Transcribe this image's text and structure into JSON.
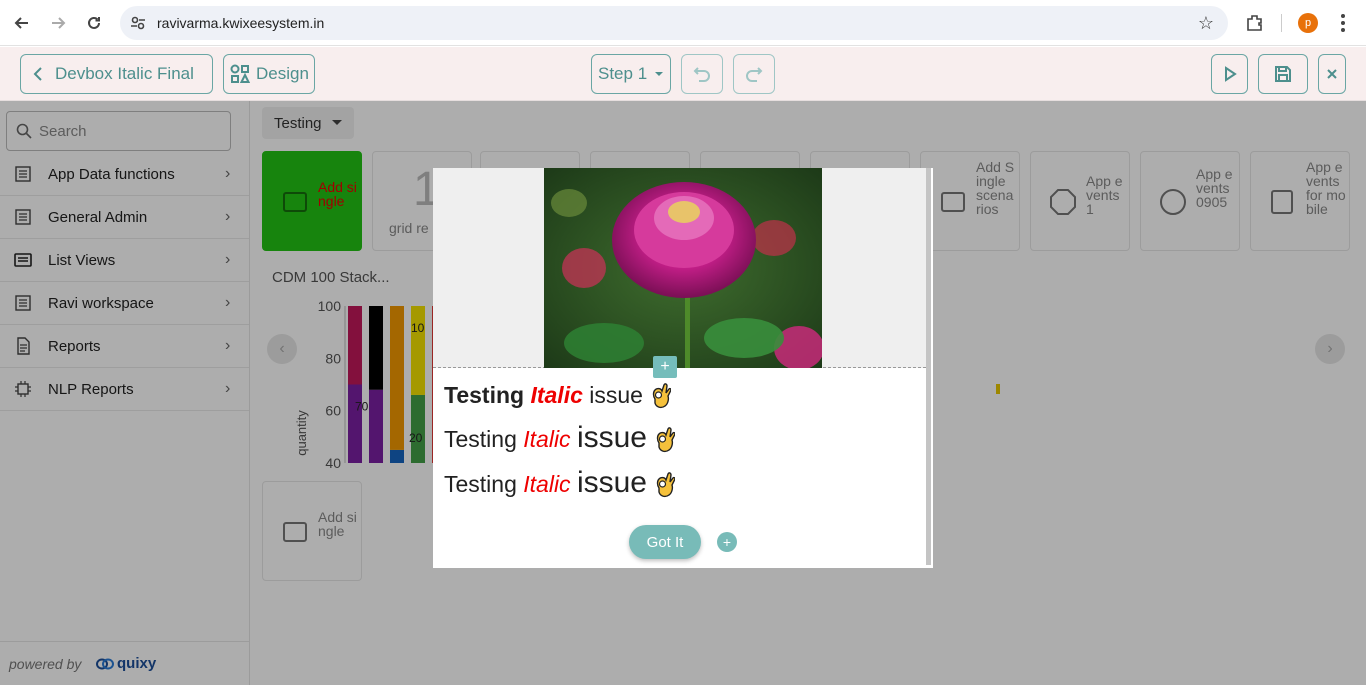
{
  "browser": {
    "url": "ravivarma.kwixeesystem.in",
    "profile_initial": "p"
  },
  "toolbar": {
    "back_label": "Devbox Italic Final",
    "design_label": "Design",
    "step_label": "Step 1"
  },
  "sidebar": {
    "search_placeholder": "Search",
    "items": [
      {
        "label": "App Data functions"
      },
      {
        "label": "General Admin"
      },
      {
        "label": "List Views"
      },
      {
        "label": "Ravi workspace"
      },
      {
        "label": "Reports"
      },
      {
        "label": "NLP Reports"
      }
    ],
    "powered_by": "powered by",
    "brand": "quixy"
  },
  "main": {
    "dropdown_label": "Testing",
    "tiles": [
      {
        "label": "Add single"
      },
      {
        "label": "grid re"
      },
      {
        "label": "Add Single scenarios"
      },
      {
        "label": "App events 1"
      },
      {
        "label": "App events 0905"
      },
      {
        "label": "App events for mobile"
      },
      {
        "label": "Add single"
      }
    ],
    "big_number": "1",
    "chart_title": "CDM 100 Stack..."
  },
  "chart_data": {
    "type": "bar",
    "ylabel": "quantity",
    "ylim": [
      40,
      100
    ],
    "yticks": [
      "100",
      "80",
      "60",
      "40"
    ],
    "data_labels": [
      "70",
      "10",
      "20"
    ],
    "colors": [
      "#c2185b",
      "#000000",
      "#f29900",
      "#f4e200",
      "#7b1fa2",
      "#1565c0",
      "#43a047",
      "#e53935"
    ]
  },
  "modal": {
    "lines": [
      {
        "w1": "Testing",
        "w2": "Italic",
        "w3": "issue"
      },
      {
        "w1": "Testing",
        "w2": "Italic",
        "w3": "issue"
      },
      {
        "w1": "Testing",
        "w2": "Italic",
        "w3": "issue"
      }
    ],
    "button_label": "Got It",
    "accent": "#78bbb8"
  }
}
